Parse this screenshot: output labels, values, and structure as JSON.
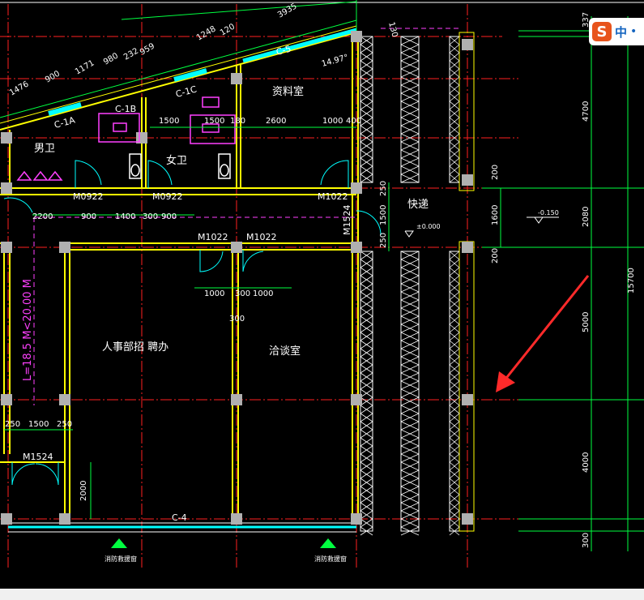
{
  "rooms": {
    "mens_wc": "男卫",
    "womens_wc": "女卫",
    "archive": "资料室",
    "hr_office": "人事部招 聘办",
    "meeting": "洽谈室",
    "express": "快递"
  },
  "windows": {
    "c1a": "C-1A",
    "c1b": "C-1B",
    "c1c": "C-1C",
    "c5": "C-5",
    "c4": "C-4"
  },
  "doors": {
    "m0922_a": "M0922",
    "m0922_b": "M0922",
    "m1022_top": "M1022",
    "m1022_left": "M1022",
    "m1022_right": "M1022",
    "m1524_right": "M1524",
    "m1524_left": "M1524"
  },
  "dimensions": {
    "slope": [
      "1476",
      "900",
      "1171",
      "980",
      "232",
      "959",
      "1248",
      "120",
      "3935"
    ],
    "d130": "130",
    "angle": "14.97°",
    "row1": [
      "1500",
      "1500",
      "180",
      "2600",
      "1000",
      "400"
    ],
    "row2": [
      "2200",
      "900",
      "1400",
      "300",
      "900"
    ],
    "door_dims": [
      "1000",
      "300",
      "1000"
    ],
    "d300_mid": "300",
    "left_bottom": [
      "250",
      "1500",
      "250"
    ],
    "d2000": "2000",
    "express_dims": [
      "250",
      "1500",
      "250"
    ],
    "right_col": [
      "337",
      "4700",
      "2080",
      "5000",
      "4000",
      "300"
    ],
    "right_inner": [
      "200",
      "1600",
      "200"
    ],
    "total": "15700",
    "elev_0": "±0.000",
    "elev_neg": "-0.150",
    "corridor_length": "L=18.5 M<20.00 M"
  },
  "annotations": {
    "hydrant_1": "消防救援窗",
    "hydrant_2": "消防救援窗"
  },
  "ime": {
    "logo": "S",
    "label": "中",
    "dot": "•"
  },
  "colors": {
    "background": "#000000",
    "wall": "#ffff00",
    "axis": "#ff0000",
    "dimension": "#00ff00",
    "text": "#ffffff",
    "fixture": "#ff00ff",
    "window": "#00ffff",
    "arrow": "#ff2a2a"
  }
}
